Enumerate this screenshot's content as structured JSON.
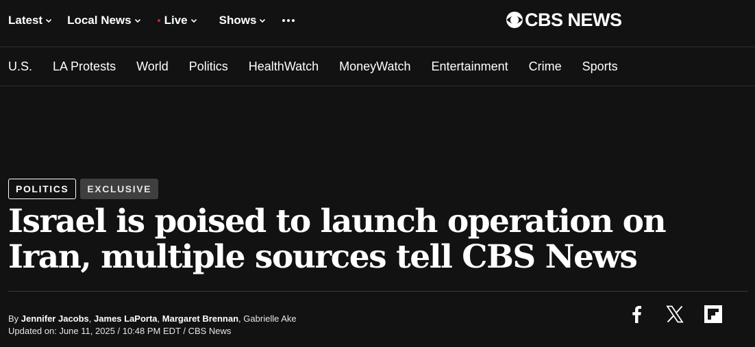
{
  "header": {
    "nav": [
      {
        "label": "Latest",
        "icon": "chevron-down-icon"
      },
      {
        "label": "Local News",
        "icon": "chevron-down-icon"
      },
      {
        "label": "Live",
        "icon": "chevron-down-icon",
        "indicator_color": "#e01e2b"
      },
      {
        "label": "Shows",
        "icon": "chevron-down-icon"
      }
    ],
    "more_icon": "more-horizontal-icon",
    "logo_text": "CBS NEWS",
    "logo_icon": "cbs-eye-icon"
  },
  "sections": [
    "U.S.",
    "LA Protests",
    "World",
    "Politics",
    "HealthWatch",
    "MoneyWatch",
    "Entertainment",
    "Crime",
    "Sports"
  ],
  "article": {
    "category": "POLITICS",
    "tag": "EXCLUSIVE",
    "headline_line1": "Israel is poised to launch operation on",
    "headline_line2": "Iran, multiple sources tell CBS News",
    "byline": {
      "prefix": "By",
      "authors": [
        "Jennifer Jacobs",
        "James LaPorta",
        "Margaret Brennan"
      ],
      "separator": ",",
      "other_author": "Gabrielle Ake"
    },
    "updated": "Updated on: June 11, 2025 / 10:48 PM EDT / CBS News"
  },
  "share": [
    "facebook-icon",
    "x-icon",
    "flipboard-icon"
  ],
  "colors": {
    "background": "#121212",
    "text": "#ffffff",
    "live_dot": "#e01e2b",
    "exclusive_bg": "#3f3f3f"
  }
}
